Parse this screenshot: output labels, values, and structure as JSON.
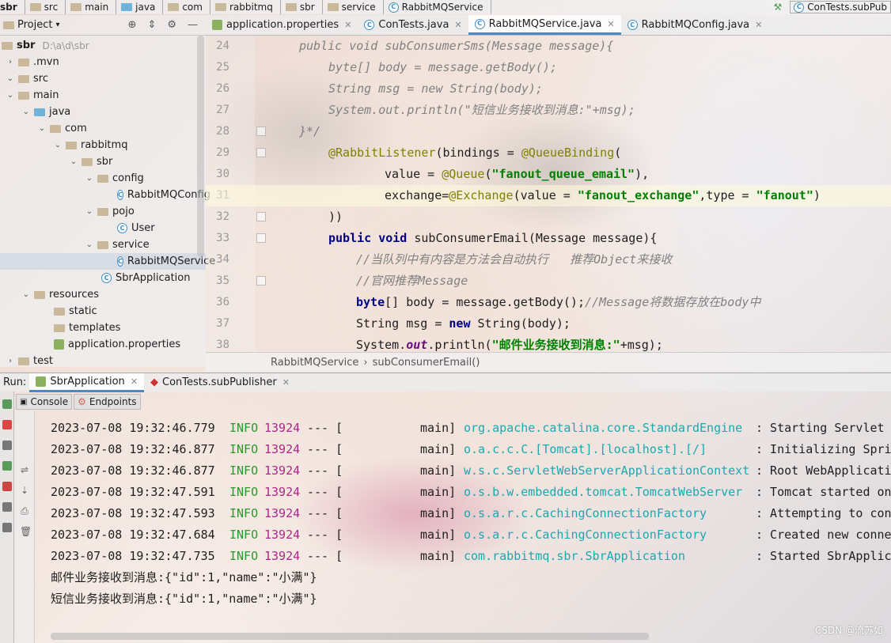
{
  "navbar": {
    "segments": [
      "sbr",
      "src",
      "main",
      "java",
      "com",
      "rabbitmq",
      "sbr",
      "service",
      "RabbitMQService"
    ],
    "run_config": "ConTests.subPub"
  },
  "project": {
    "header": "Project",
    "root_name": "sbr",
    "root_path": "D:\\a\\d\\sbr",
    "tree": [
      {
        "label": ".mvn"
      },
      {
        "label": "src"
      },
      {
        "label": "main"
      },
      {
        "label": "java"
      },
      {
        "label": "com"
      },
      {
        "label": "rabbitmq"
      },
      {
        "label": "sbr"
      },
      {
        "label": "config"
      },
      {
        "label": "RabbitMQConfig"
      },
      {
        "label": "pojo"
      },
      {
        "label": "User"
      },
      {
        "label": "service"
      },
      {
        "label": "RabbitMQService"
      },
      {
        "label": "SbrApplication"
      },
      {
        "label": "resources"
      },
      {
        "label": "static"
      },
      {
        "label": "templates"
      },
      {
        "label": "application.properties"
      },
      {
        "label": "test"
      }
    ]
  },
  "editor": {
    "tabs": [
      "application.properties",
      "ConTests.java",
      "RabbitMQService.java",
      "RabbitMQConfig.java"
    ],
    "active_tab": "RabbitMQService.java",
    "line_numbers": [
      "24",
      "25",
      "26",
      "27",
      "28",
      "29",
      "30",
      "31",
      "32",
      "33",
      "34",
      "35",
      "36",
      "37",
      "38"
    ],
    "code": {
      "l24": "public void subConsumerSms(Message message){",
      "l25": "byte[] body = message.getBody();",
      "l26": "String msg = new String(body);",
      "l27": "System.out.println(\"短信业务接收到消息:\"+msg);",
      "l28": "}*/",
      "l29a": "@RabbitListener",
      "l29b": "(bindings = ",
      "l29c": "@QueueBinding",
      "l29d": "(",
      "l30a": "value = ",
      "l30b": "@Queue",
      "l30c": "(",
      "l30d": "\"fanout_queue_email\"",
      "l30e": "),",
      "l31a": "exchange=",
      "l31b": "@Exchange",
      "l31c": "(value = ",
      "l31d": "\"fanout_exchange\"",
      "l31e": ",type = ",
      "l31f": "\"fanout\"",
      "l31g": ")",
      "l32": "))",
      "l33a": "public void",
      "l33b": " subConsumerEmail(Message message){",
      "l34": "//当队列中有内容是方法会自动执行   推荐Object来接收",
      "l35": "//官网推荐Message",
      "l36a": "byte",
      "l36b": "[] body = message.getBody();",
      "l36c": "//Message将数据存放在body中",
      "l37a": "String msg = ",
      "l37b": "new",
      "l37c": " String(body);",
      "l38a": "System.",
      "l38b": "out",
      "l38c": ".println(",
      "l38d": "\"邮件业务接收到消息:\"",
      "l38e": "+msg);"
    },
    "breadcrumb": [
      "RabbitMQService",
      "subConsumerEmail()"
    ]
  },
  "run": {
    "label": "Run:",
    "tabs": [
      "SbrApplication",
      "ConTests.subPublisher"
    ],
    "console_tabs": [
      "Console",
      "Endpoints"
    ]
  },
  "console": {
    "logs": [
      {
        "ts": "2023-07-08 19:32:46.779",
        "level": "INFO",
        "pid": "13924",
        "sep": "--- [",
        "thread": "main]",
        "logger": "org.apache.catalina.core.StandardEngine",
        "msg": ": Starting Servlet"
      },
      {
        "ts": "2023-07-08 19:32:46.877",
        "level": "INFO",
        "pid": "13924",
        "sep": "--- [",
        "thread": "main]",
        "logger": "o.a.c.c.C.[Tomcat].[localhost].[/]",
        "msg": ": Initializing Spri"
      },
      {
        "ts": "2023-07-08 19:32:46.877",
        "level": "INFO",
        "pid": "13924",
        "sep": "--- [",
        "thread": "main]",
        "logger": "w.s.c.ServletWebServerApplicationContext",
        "msg": ": Root WebApplicati"
      },
      {
        "ts": "2023-07-08 19:32:47.591",
        "level": "INFO",
        "pid": "13924",
        "sep": "--- [",
        "thread": "main]",
        "logger": "o.s.b.w.embedded.tomcat.TomcatWebServer",
        "msg": ": Tomcat started on"
      },
      {
        "ts": "2023-07-08 19:32:47.593",
        "level": "INFO",
        "pid": "13924",
        "sep": "--- [",
        "thread": "main]",
        "logger": "o.s.a.r.c.CachingConnectionFactory",
        "msg": ": Attempting to con"
      },
      {
        "ts": "2023-07-08 19:32:47.684",
        "level": "INFO",
        "pid": "13924",
        "sep": "--- [",
        "thread": "main]",
        "logger": "o.s.a.r.c.CachingConnectionFactory",
        "msg": ": Created new conne"
      },
      {
        "ts": "2023-07-08 19:32:47.735",
        "level": "INFO",
        "pid": "13924",
        "sep": "--- [",
        "thread": "main]",
        "logger": "com.rabbitmq.sbr.SbrApplication",
        "msg": ": Started SbrApplic"
      }
    ],
    "output": [
      "邮件业务接收到消息:{\"id\":1,\"name\":\"小满\"}",
      "短信业务接收到消息:{\"id\":1,\"name\":\"小满\"}"
    ]
  },
  "watermark": "CSDN @流苏如",
  "colors": {
    "accent": "#4a88c7",
    "keyword": "#000080",
    "string": "#008000",
    "annotation": "#808000",
    "comment": "#808080",
    "info": "#2a9a2a",
    "pid": "#b0258b",
    "logger": "#1ba8b0"
  }
}
